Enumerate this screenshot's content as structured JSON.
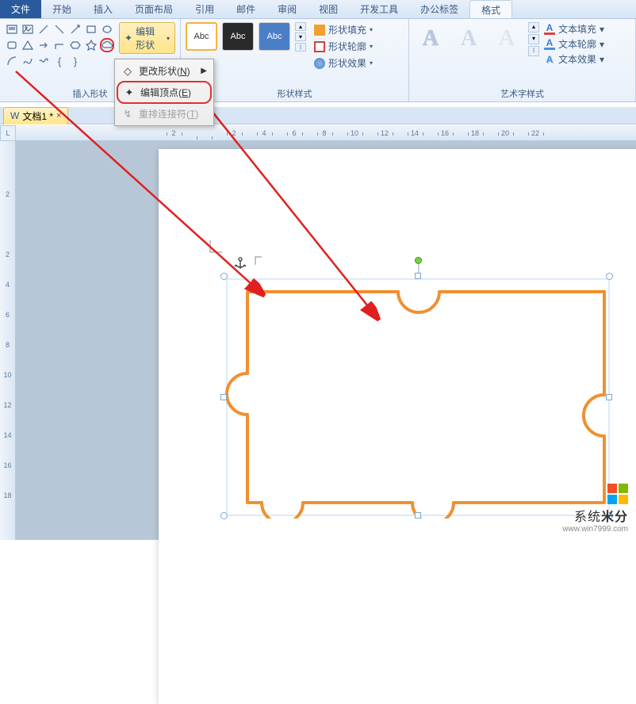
{
  "tabs": {
    "file": "文件",
    "home": "开始",
    "insert": "插入",
    "layout": "页面布局",
    "references": "引用",
    "mailings": "邮件",
    "review": "审阅",
    "view": "视图",
    "developer": "开发工具",
    "officetab": "办公标签",
    "format": "格式"
  },
  "ribbon": {
    "insert_shapes_label": "插入形状",
    "edit_shape_btn": "编辑形状",
    "shape_styles_label": "形状样式",
    "wordart_styles_label": "艺术字样式",
    "abc": "Abc",
    "shape_fill": "形状填充",
    "shape_outline": "形状轮廓",
    "shape_effects": "形状效果",
    "text_fill": "文本填充",
    "text_outline": "文本轮廓",
    "text_effects": "文本效果",
    "wa_letter": "A"
  },
  "menu": {
    "change_shape": "更改形状(",
    "change_shape_key": "N",
    "change_shape_end": ")",
    "edit_points": "编辑顶点(",
    "edit_points_key": "E",
    "edit_points_end": ")",
    "reroute": "重排连接符(",
    "reroute_key": "T",
    "reroute_end": ")"
  },
  "doc_tab": {
    "name": "文档1",
    "marker": "*"
  },
  "ruler_corner": "L",
  "h_ruler_marks": [
    "2",
    "",
    "2",
    "4",
    "6",
    "8",
    "10",
    "12",
    "14",
    "16",
    "18",
    "20",
    "22"
  ],
  "v_ruler_marks": [
    "",
    "2",
    "",
    "2",
    "4",
    "6",
    "8",
    "10",
    "12",
    "14",
    "16",
    "18"
  ],
  "watermark": {
    "text1": "系统",
    "text2": "米分",
    "url": "www.win7999.com"
  },
  "colors": {
    "puzzle_stroke": "#f09030",
    "arrow": "#e02020",
    "logo": [
      "#f25022",
      "#7fba00",
      "#00a4ef",
      "#ffb900"
    ]
  }
}
